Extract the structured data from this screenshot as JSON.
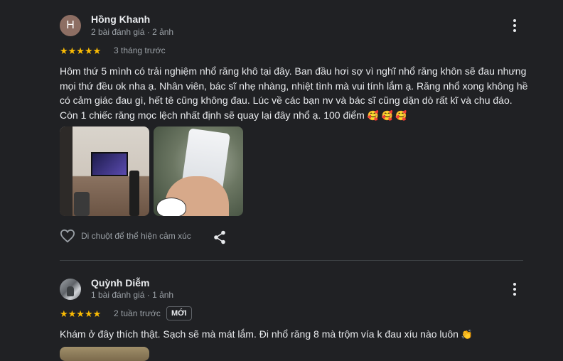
{
  "reviews": [
    {
      "author": "Hồng Khanh",
      "avatar_letter": "H",
      "meta": "2 bài đánh giá · 2 ảnh",
      "stars": "★★★★★",
      "rating": 5,
      "time": "3 tháng trước",
      "text": "Hôm thứ 5 mình có trải nghiệm nhổ răng khô tại đây. Ban đầu hơi sợ vì nghĩ nhổ răng khôn sẽ đau nhưng mọi thứ đều ok nha ạ. Nhân viên, bác sĩ nhẹ nhàng, nhiệt tình mà vui tính lắm ạ. Răng nhổ xong không hề có cảm giác đau gì, hết tê cũng không đau. Lúc về các bạn nv và bác sĩ cũng dặn dò rất kĩ và chu đáo. Còn 1 chiếc răng mọc lệch nhất định sẽ quay lại đây nhổ ạ. 100 điểm",
      "emojis": "🥰 🥰 🥰",
      "react_label": "Di chuột để thể hiện cảm xúc"
    },
    {
      "author": "Quỳnh Diễm",
      "meta": "1 bài đánh giá · 1 ảnh",
      "stars": "★★★★★",
      "rating": 5,
      "time": "2 tuần trước",
      "badge": "MỚI",
      "text": "Khám ở đây thích thật. Sạch sẽ mà mát lắm. Đi nhổ răng 8 mà trộm vía k đau xíu nào luôn",
      "emojis": "👏"
    }
  ],
  "icons": {
    "more": "more-vert-icon",
    "heart": "heart-outline-icon",
    "share": "share-icon"
  },
  "colors": {
    "background": "#202124",
    "star": "#fbbc04",
    "text": "#e8eaed",
    "secondary": "#9aa0a6"
  }
}
